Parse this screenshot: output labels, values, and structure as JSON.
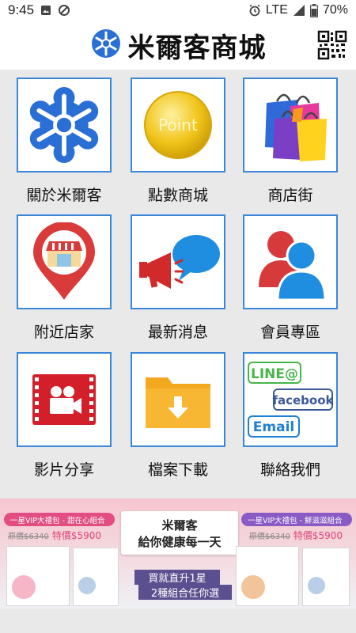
{
  "status_bar": {
    "time": "9:45",
    "network": "LTE",
    "battery": "70%"
  },
  "header": {
    "title": "米爾客商城",
    "qr_label": "qr-code"
  },
  "menu": [
    {
      "label": "關於米爾客",
      "icon": "snowflake-logo-icon"
    },
    {
      "label": "點數商城",
      "icon": "point-coin-icon",
      "coin_text": "Point"
    },
    {
      "label": "商店街",
      "icon": "shopping-bags-icon"
    },
    {
      "label": "附近店家",
      "icon": "store-location-pin-icon"
    },
    {
      "label": "最新消息",
      "icon": "megaphone-chat-icon"
    },
    {
      "label": "會員專區",
      "icon": "members-icon"
    },
    {
      "label": "影片分享",
      "icon": "video-camera-icon"
    },
    {
      "label": "檔案下載",
      "icon": "download-folder-icon"
    },
    {
      "label": "聯絡我們",
      "icon": "contact-channels-icon",
      "contact_labels": [
        "LINE@",
        "facebook",
        "Email"
      ]
    }
  ],
  "banner": {
    "left_offer": "一星VIP大禮包 - 甜在心組合",
    "left_price_original": "原價$6340",
    "left_price_sale": "特價$5900",
    "right_offer": "一星VIP大禮包 - 鮮滋滋組合",
    "right_price_original": "原價$6340",
    "right_price_sale": "特價$5900",
    "slogan_line1": "米爾客",
    "slogan_line2": "給你健康每一天",
    "promo_line1": "買就直升1星",
    "promo_line2": "2種組合任你選",
    "accent_pink": "#e24d82",
    "accent_purple": "#5b4f8f"
  },
  "colors": {
    "tile_border": "#3a86d8",
    "brand_blue": "#2a6fd6",
    "background": "#e9e9e9"
  }
}
